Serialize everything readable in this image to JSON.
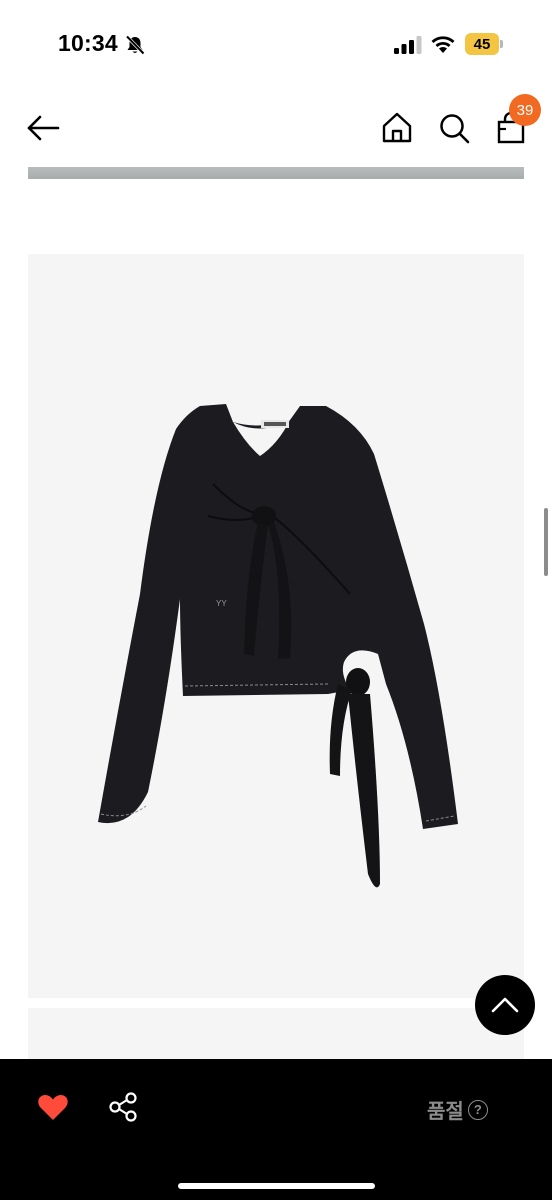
{
  "status_bar": {
    "time": "10:34",
    "battery_level": "45",
    "battery_color": "#f4c542",
    "icons": [
      "mute-bell-icon",
      "signal-icon",
      "wifi-icon",
      "battery-icon"
    ]
  },
  "header": {
    "icons": [
      "back-arrow-icon",
      "home-icon",
      "search-icon",
      "shopping-bag-icon"
    ],
    "cart_count": "39",
    "badge_color": "#f26a21"
  },
  "product": {
    "garment_print": "YY",
    "garment_color": "#1c1c20"
  },
  "bottom_bar": {
    "like_color": "#ff4b3a",
    "sold_out_label": "품절",
    "help_symbol": "?",
    "icons": [
      "heart-icon",
      "share-icon",
      "help-icon"
    ]
  },
  "floating": {
    "icon": "chevron-up-icon"
  }
}
